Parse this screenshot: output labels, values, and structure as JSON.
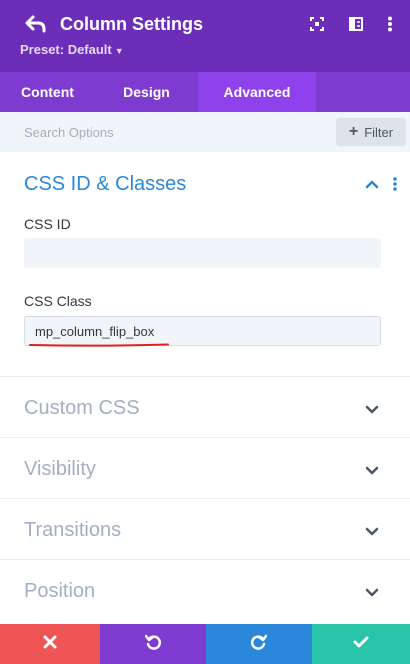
{
  "header": {
    "title": "Column Settings",
    "preset_label": "Preset: Default",
    "icons": [
      "back-icon",
      "focus-icon",
      "split-view-icon",
      "more-vertical-icon"
    ],
    "colors": {
      "background": "#6c2eb9",
      "text": "#ffffff"
    }
  },
  "tabs": [
    {
      "label": "Content",
      "active": false
    },
    {
      "label": "Design",
      "active": false
    },
    {
      "label": "Advanced",
      "active": true
    }
  ],
  "search": {
    "placeholder": "Search Options",
    "value": "",
    "filter_label": "Filter"
  },
  "sections": {
    "css_id_classes": {
      "title": "CSS ID & Classes",
      "expanded": true,
      "fields": {
        "css_id": {
          "label": "CSS ID",
          "value": ""
        },
        "css_class": {
          "label": "CSS Class",
          "value": "mp_column_flip_box"
        }
      }
    },
    "collapsed": [
      {
        "title": "Custom CSS",
        "expanded": false
      },
      {
        "title": "Visibility",
        "expanded": false
      },
      {
        "title": "Transitions",
        "expanded": false
      },
      {
        "title": "Position",
        "expanded": false
      }
    ]
  },
  "footer": {
    "buttons": [
      {
        "icon": "close-icon",
        "color": "#ef5555"
      },
      {
        "icon": "undo-icon",
        "color": "#7e3bd0"
      },
      {
        "icon": "redo-icon",
        "color": "#2b87da"
      },
      {
        "icon": "check-icon",
        "color": "#29c4a9"
      }
    ]
  },
  "colors": {
    "accent_blue": "#2b87da",
    "annotation_red": "#e0211b"
  }
}
